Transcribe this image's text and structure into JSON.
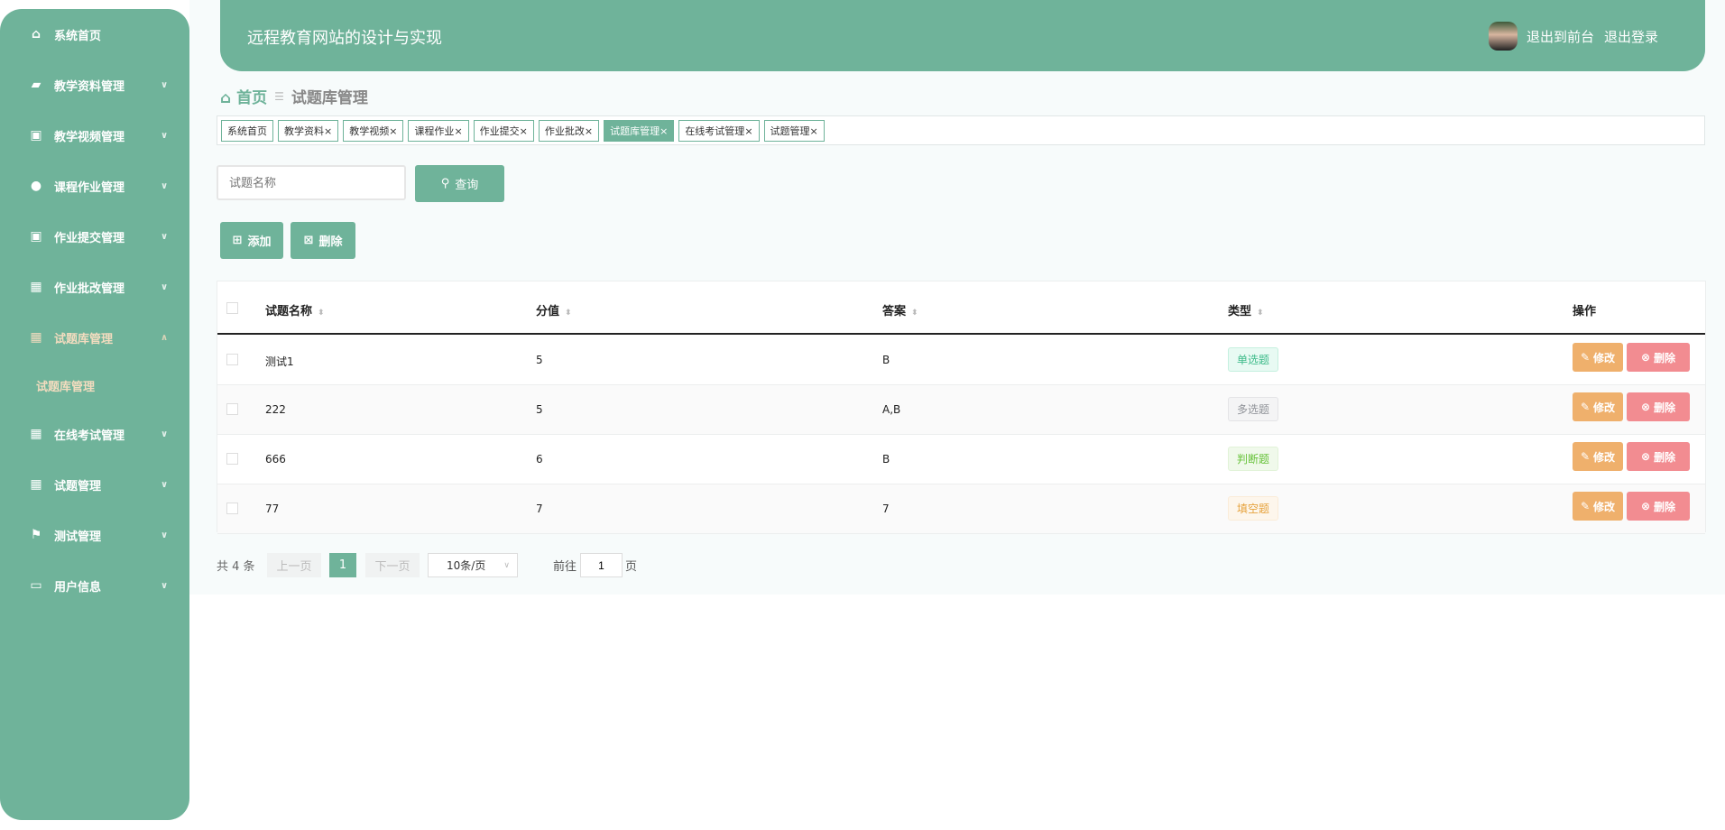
{
  "header": {
    "title": "远程教育网站的设计与实现",
    "links": [
      "退出到前台",
      "退出登录"
    ]
  },
  "sidebar": {
    "items": [
      {
        "label": "系统首页",
        "icon": "home-icon"
      },
      {
        "label": "教学资料管理",
        "icon": "wallet-icon"
      },
      {
        "label": "教学视频管理",
        "icon": "clipboard-x-icon"
      },
      {
        "label": "课程作业管理",
        "icon": "bulb-icon"
      },
      {
        "label": "作业提交管理",
        "icon": "clipboard-check-icon"
      },
      {
        "label": "作业批改管理",
        "icon": "grid-icon"
      },
      {
        "label": "试题库管理",
        "icon": "grid-icon"
      },
      {
        "label": "试题库管理",
        "icon": ""
      },
      {
        "label": "在线考试管理",
        "icon": "grid-icon"
      },
      {
        "label": "试题管理",
        "icon": "grid-icon"
      },
      {
        "label": "测试管理",
        "icon": "flag-icon"
      },
      {
        "label": "用户信息",
        "icon": "card-icon"
      }
    ]
  },
  "breadcrumb": {
    "home": "首页",
    "current": "试题库管理"
  },
  "tabs": [
    "系统首页",
    "教学资料",
    "教学视频",
    "课程作业",
    "作业提交",
    "作业批改",
    "试题库管理",
    "在线考试管理",
    "试题管理"
  ],
  "search": {
    "placeholder": "试题名称",
    "button": "查询"
  },
  "actions": {
    "add": "添加",
    "delete": "删除"
  },
  "table": {
    "columns": [
      "试题名称",
      "分值",
      "答案",
      "类型",
      "操作"
    ],
    "rows": [
      {
        "name": "测试1",
        "score": "5",
        "answer": "B",
        "type": "单选题"
      },
      {
        "name": "222",
        "score": "5",
        "answer": "A,B",
        "type": "多选题"
      },
      {
        "name": "666",
        "score": "6",
        "answer": "B",
        "type": "判断题"
      },
      {
        "name": "77",
        "score": "7",
        "answer": "7",
        "type": "填空题"
      }
    ],
    "edit": "修改",
    "delete": "删除"
  },
  "pagination": {
    "total": "共 4 条",
    "prev": "上一页",
    "page": "1",
    "next": "下一页",
    "size": "10条/页",
    "goto": "前往",
    "goto_value": "1",
    "page_unit": "页"
  },
  "colors": {
    "primary": "#6fb39a",
    "edit": "#efb06c",
    "delete": "#f28c91"
  }
}
